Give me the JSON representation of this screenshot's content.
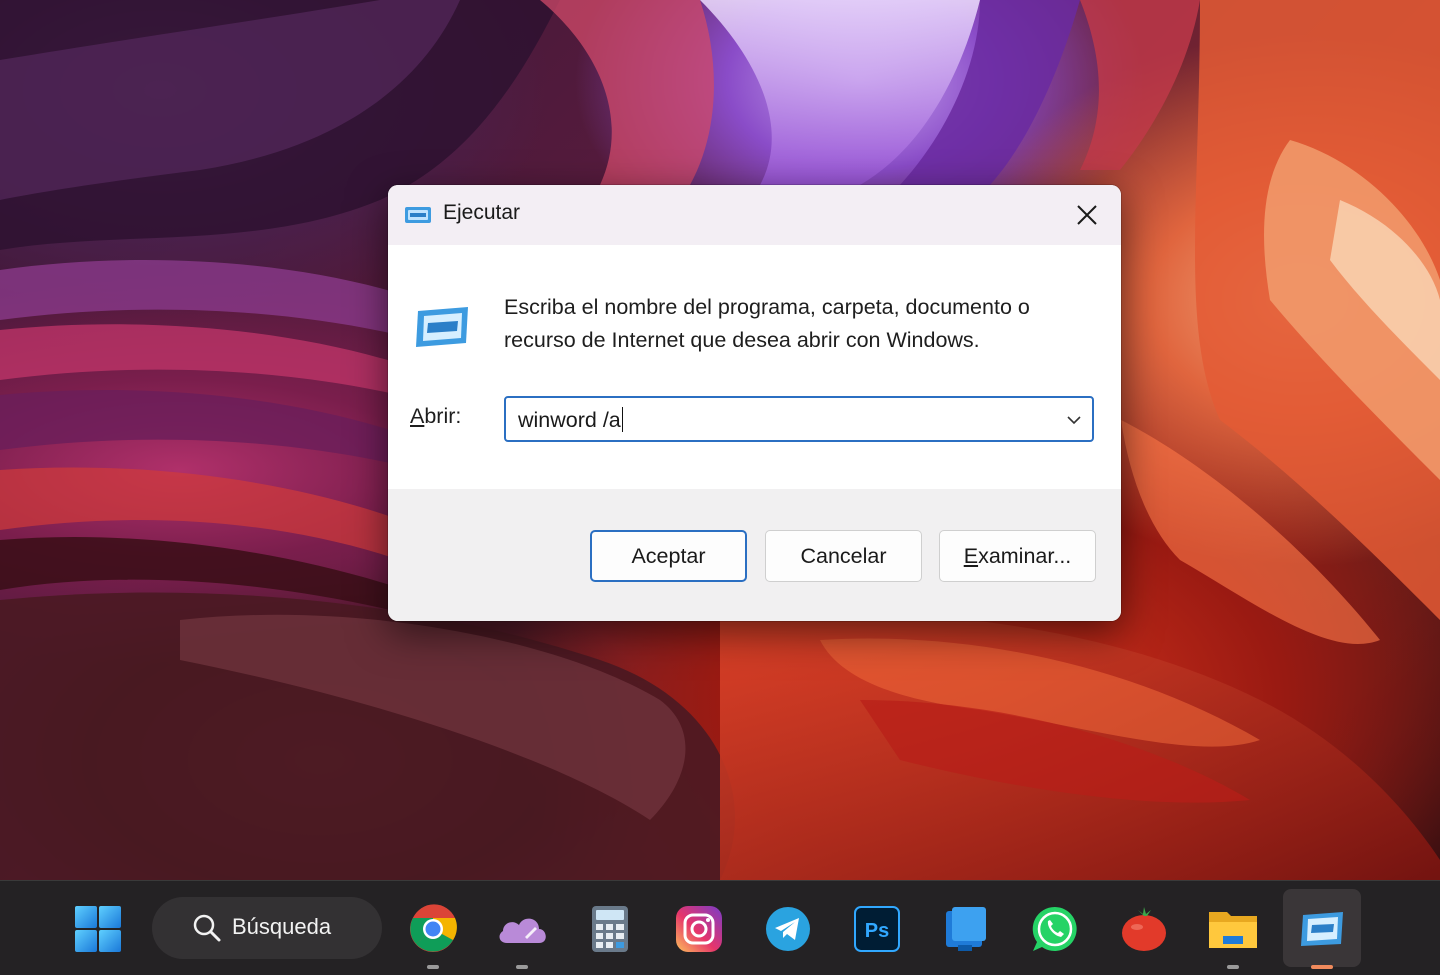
{
  "dialog": {
    "title": "Ejecutar",
    "description": "Escriba el nombre del programa, carpeta, documento o recurso de Internet que desea abrir con Windows.",
    "open_label_first": "A",
    "open_label_rest": "brir:",
    "input_value": "winword /a",
    "buttons": {
      "ok": "Aceptar",
      "cancel": "Cancelar",
      "browse_first": "E",
      "browse_rest": "xaminar..."
    },
    "accent_color": "#2b6fc2"
  },
  "taskbar": {
    "search_label": "Búsqueda",
    "icons": [
      {
        "name": "start-icon",
        "running": false
      },
      {
        "name": "chrome-icon",
        "running": true
      },
      {
        "name": "onedrive-icon",
        "running": true
      },
      {
        "name": "calculator-icon",
        "running": false
      },
      {
        "name": "instagram-icon",
        "running": false
      },
      {
        "name": "telegram-icon",
        "running": false
      },
      {
        "name": "photoshop-icon",
        "running": false
      },
      {
        "name": "notes-icon",
        "running": false
      },
      {
        "name": "whatsapp-icon",
        "running": false
      },
      {
        "name": "tomato-icon",
        "running": false
      },
      {
        "name": "file-explorer-icon",
        "running": true
      },
      {
        "name": "run-icon",
        "running": true,
        "active": true
      }
    ]
  }
}
